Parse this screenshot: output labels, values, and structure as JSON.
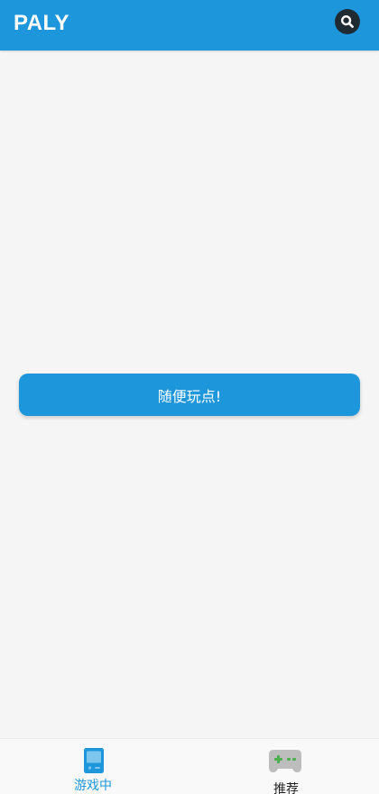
{
  "app_bar": {
    "title": "PALY",
    "background_color": "#1e96dc",
    "search_icon": "search-icon"
  },
  "main": {
    "play_button_label": "随便玩点!",
    "play_button_color": "#1e96dc"
  },
  "bottom_nav": {
    "items": [
      {
        "label": "游戏中",
        "icon": "handheld-console-icon",
        "active": true,
        "color": "#1e96dc"
      },
      {
        "label": "推荐",
        "icon": "gamepad-icon",
        "active": false,
        "color": "#222222"
      }
    ]
  }
}
